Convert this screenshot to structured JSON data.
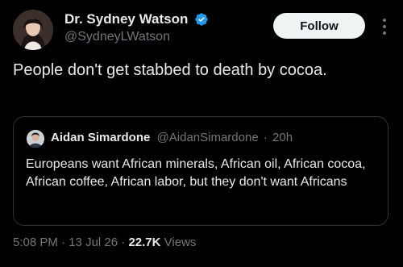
{
  "author": {
    "display_name": "Dr. Sydney Watson",
    "handle": "@SydneyLWatson",
    "verified_icon": "verified-badge-icon",
    "verified_color": "#1d9bf0"
  },
  "follow_label": "Follow",
  "tweet_text": "People don't get stabbed to death by cocoa.",
  "quote": {
    "name": "Aidan Simardone",
    "handle": "@AidanSimardone",
    "separator": "·",
    "time": "20h",
    "text": "Europeans want African minerals, African oil, African cocoa, African coffee, African labor, but they don't want Africans"
  },
  "footer": {
    "time": "5:08 PM",
    "sep1": "·",
    "date": "13 Jul 26",
    "sep2": "·",
    "views_count": "22.7K",
    "views_label": "Views"
  },
  "colors": {
    "background": "#000000",
    "text": "#e7e9ea",
    "muted": "#71767b",
    "border": "#2f3336",
    "button_bg": "#eff3f4"
  }
}
